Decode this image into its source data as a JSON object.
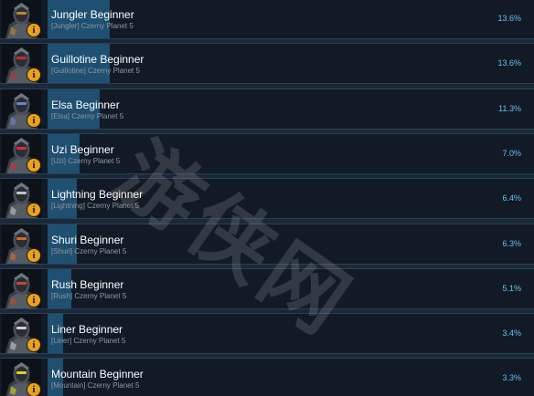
{
  "achievements": [
    {
      "title": "Jungler Beginner",
      "description": "[Jungler] Czerny Planet 5",
      "percent_label": "13.6%",
      "percent": 13.6,
      "icon": "jungler-portrait-icon",
      "accent": "#b8892a"
    },
    {
      "title": "Guillotine Beginner",
      "description": "[Guillotine] Czerny Planet 5",
      "percent_label": "13.6%",
      "percent": 13.6,
      "icon": "guillotine-portrait-icon",
      "accent": "#c23030"
    },
    {
      "title": "Elsa Beginner",
      "description": "[Elsa] Czerny Planet 5",
      "percent_label": "11.3%",
      "percent": 11.3,
      "icon": "elsa-portrait-icon",
      "accent": "#6a86c8"
    },
    {
      "title": "Uzi Beginner",
      "description": "[Uzi] Czerny Planet 5",
      "percent_label": "7.0%",
      "percent": 7.0,
      "icon": "uzi-portrait-icon",
      "accent": "#d0303a"
    },
    {
      "title": "Lightning Beginner",
      "description": "[Lightning] Czerny Planet 5",
      "percent_label": "6.4%",
      "percent": 6.4,
      "icon": "lightning-portrait-icon",
      "accent": "#c0c4cc"
    },
    {
      "title": "Shuri Beginner",
      "description": "[Shuri] Czerny Planet 5",
      "percent_label": "6.3%",
      "percent": 6.3,
      "icon": "shuri-portrait-icon",
      "accent": "#d06a2a"
    },
    {
      "title": "Rush Beginner",
      "description": "[Rush] Czerny Planet 5",
      "percent_label": "5.1%",
      "percent": 5.1,
      "icon": "rush-portrait-icon",
      "accent": "#c04a2a"
    },
    {
      "title": "Liner Beginner",
      "description": "[Liner] Czerny Planet 5",
      "percent_label": "3.4%",
      "percent": 3.4,
      "icon": "liner-portrait-icon",
      "accent": "#d0c8d8"
    },
    {
      "title": "Mountain Beginner",
      "description": "[Mountain] Czerny Planet 5",
      "percent_label": "3.3%",
      "percent": 3.3,
      "icon": "mountain-portrait-icon",
      "accent": "#e0d020"
    }
  ],
  "badge_glyph": "i",
  "watermark": "游侠网",
  "colors": {
    "background": "#1b2838",
    "row": "#121a25",
    "bar": "#1f4f71",
    "percent_text": "#66c0f4",
    "badge": "#e8a21e"
  }
}
